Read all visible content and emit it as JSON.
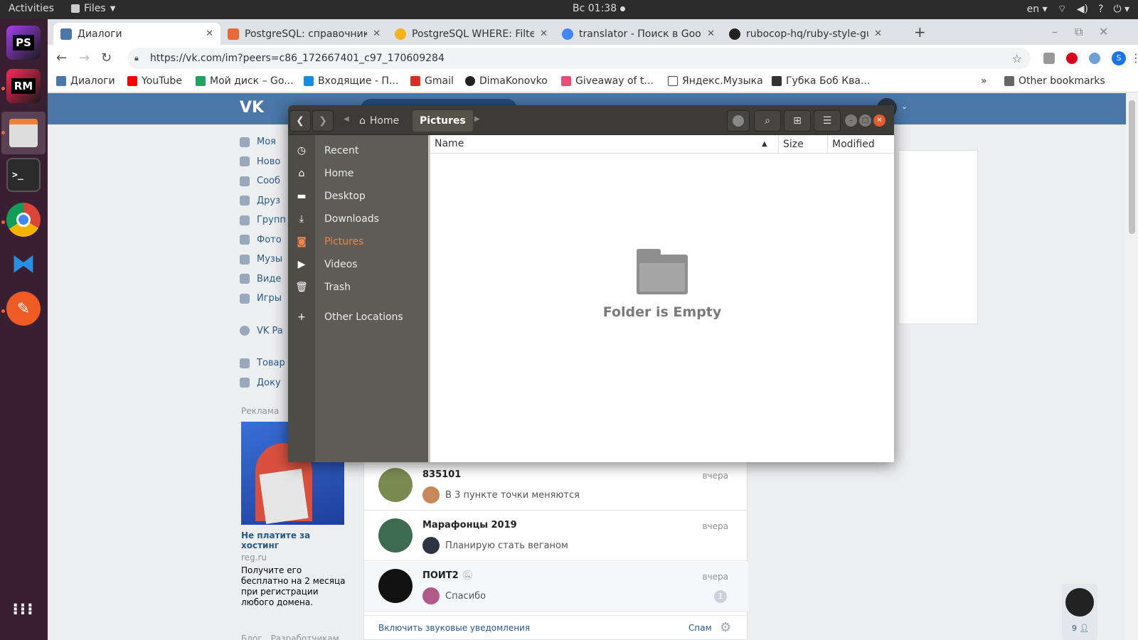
{
  "topbar": {
    "activities": "Activities",
    "app_menu": "Files",
    "clock": "Вс 01:38",
    "lang": "en"
  },
  "dock": {
    "items": [
      "PS",
      "RM"
    ]
  },
  "browser": {
    "tabs": [
      {
        "title": "Диалоги",
        "color": "#4a76a8"
      },
      {
        "title": "PostgreSQL: справочник",
        "color": "#e8683a"
      },
      {
        "title": "PostgreSQL WHERE: Filte",
        "color": "#f3b31b"
      },
      {
        "title": "translator - Поиск в Goog",
        "color": "#4285f4"
      },
      {
        "title": "rubocop-hq/ruby-style-gu",
        "color": "#222222"
      }
    ],
    "url": "https://vk.com/im?peers=c86_172667401_c97_170609284",
    "bookmarks": [
      {
        "label": "Диалоги",
        "color": "#4a76a8"
      },
      {
        "label": "YouTube",
        "color": "#ff0000"
      },
      {
        "label": "Мой диск – Go...",
        "color": "#1fa463"
      },
      {
        "label": "Входящие - П...",
        "color": "#168de2"
      },
      {
        "label": "Gmail",
        "color": "#d93025"
      },
      {
        "label": "DimaKonovko",
        "color": "#222222"
      },
      {
        "label": "Giveaway of t...",
        "color": "#e94e77"
      },
      {
        "label": "Яндекс.Музыка",
        "color": "#444444"
      },
      {
        "label": "Губка Боб Ква...",
        "color": "#333333"
      }
    ],
    "other_bookmarks": "Other bookmarks"
  },
  "vk": {
    "sidebar": [
      "Моя",
      "Ново",
      "Сооб",
      "Друз",
      "Групп",
      "Фото",
      "Музы",
      "Виде",
      "Игры",
      "VK Pa",
      "Товар",
      "Доку"
    ],
    "ad_label": "Реклама",
    "ad_title": "Не платите за хостинг",
    "ad_domain": "reg.ru",
    "ad_text": "Получите его бесплатно на 2 месяца при регистрации любого домена.",
    "chats": [
      {
        "name": "835101",
        "time": "вчера",
        "msg": "В 3 пункте точки меняются",
        "avatar": "#7a8b52"
      },
      {
        "name": "Марафонцы 2019",
        "time": "вчера",
        "msg": "Планирую стать веганом",
        "avatar": "#3d6b4f"
      },
      {
        "name": "ПОИТ2",
        "time": "вчера",
        "msg": "Спасибо",
        "avatar": "#111111"
      }
    ],
    "unread": "1",
    "footer_sound": "Включить звуковые уведомления",
    "footer_spam": "Спам",
    "footer_links": [
      "Блог",
      "Разработчикам"
    ],
    "online_count": "9"
  },
  "files": {
    "crumbs": {
      "home": "Home",
      "current": "Pictures"
    },
    "places": [
      {
        "label": "Recent",
        "icon": "clock-icon"
      },
      {
        "label": "Home",
        "icon": "home-icon"
      },
      {
        "label": "Desktop",
        "icon": "folder-icon"
      },
      {
        "label": "Downloads",
        "icon": "download-icon"
      },
      {
        "label": "Pictures",
        "icon": "camera-icon"
      },
      {
        "label": "Videos",
        "icon": "video-icon"
      },
      {
        "label": "Trash",
        "icon": "trash-icon"
      },
      {
        "label": "Other Locations",
        "icon": "plus-icon"
      }
    ],
    "columns": {
      "name": "Name",
      "size": "Size",
      "modified": "Modified"
    },
    "empty_label": "Folder is Empty"
  }
}
